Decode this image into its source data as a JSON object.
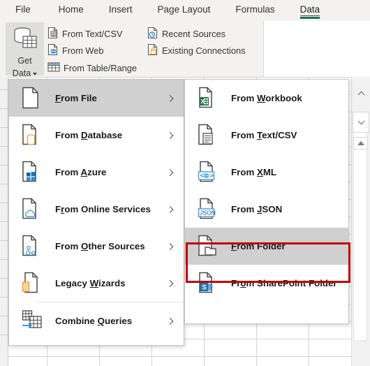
{
  "app": {
    "name": "Microsoft Excel",
    "accent_green": "#1e6f50",
    "highlight_gray": "#d0d0d0",
    "callout_red": "#c00000"
  },
  "tabs": [
    {
      "label": "File",
      "active": false
    },
    {
      "label": "Home",
      "active": false
    },
    {
      "label": "Insert",
      "active": false
    },
    {
      "label": "Page Layout",
      "active": false
    },
    {
      "label": "Formulas",
      "active": false
    },
    {
      "label": "Data",
      "active": true
    }
  ],
  "ribbon": {
    "get_data": {
      "line1": "Get",
      "line2": "Data",
      "icon": "database-table-icon",
      "dropdown_caret": "chevron-down-icon",
      "pressed": true
    },
    "commands": [
      {
        "label": "From Text/CSV",
        "icon": "text-csv-icon"
      },
      {
        "label": "From Web",
        "icon": "globe-web-icon"
      },
      {
        "label": "From Table/Range",
        "icon": "table-range-icon"
      },
      {
        "label": "Recent Sources",
        "icon": "recent-clock-icon"
      },
      {
        "label": "Existing Connections",
        "icon": "existing-connections-icon"
      }
    ]
  },
  "menu_main": {
    "name": "Get Data menu",
    "items": [
      {
        "label": "From File",
        "accel": "F",
        "icon": "file-icon",
        "submenu": true,
        "highlighted": true
      },
      {
        "label": "From Database",
        "accel": "D",
        "icon": "database-file-icon",
        "submenu": true,
        "highlighted": false
      },
      {
        "label": "From Azure",
        "accel": "A",
        "icon": "azure-file-icon",
        "submenu": true,
        "highlighted": false
      },
      {
        "label": "From Online Services",
        "accel": "r",
        "icon": "cloud-file-icon",
        "submenu": true,
        "highlighted": false
      },
      {
        "label": "From Other Sources",
        "accel": "O",
        "icon": "other-sources-icon",
        "submenu": true,
        "highlighted": false
      },
      {
        "label": "Legacy Wizards",
        "accel": "W",
        "icon": "legacy-wizards-icon",
        "submenu": true,
        "highlighted": false
      },
      {
        "label": "Combine Queries",
        "accel": "Q",
        "icon": "combine-queries-icon",
        "submenu": true,
        "highlighted": false
      }
    ],
    "separator_before_index": 6
  },
  "menu_sub": {
    "name": "From File submenu",
    "items": [
      {
        "label": "From Workbook",
        "accel": "W",
        "icon": "excel-workbook-icon",
        "highlighted": false,
        "callout": false
      },
      {
        "label": "From Text/CSV",
        "accel": "T",
        "icon": "text-document-icon",
        "highlighted": false,
        "callout": false
      },
      {
        "label": "From XML",
        "accel": "X",
        "icon": "xml-icon",
        "highlighted": false,
        "callout": false
      },
      {
        "label": "From JSON",
        "accel": "J",
        "icon": "json-icon",
        "highlighted": false,
        "callout": false
      },
      {
        "label": "From Folder",
        "accel": "F",
        "icon": "folder-file-icon",
        "highlighted": true,
        "callout": true
      },
      {
        "label": "From SharePoint Folder",
        "accel": "o",
        "icon": "sharepoint-icon",
        "highlighted": false,
        "callout": false
      }
    ]
  },
  "scrollbar": {
    "up_arrow": "chevron-up-icon",
    "down_arrow": "chevron-down-icon",
    "split_arrow": "triangle-up-icon"
  }
}
